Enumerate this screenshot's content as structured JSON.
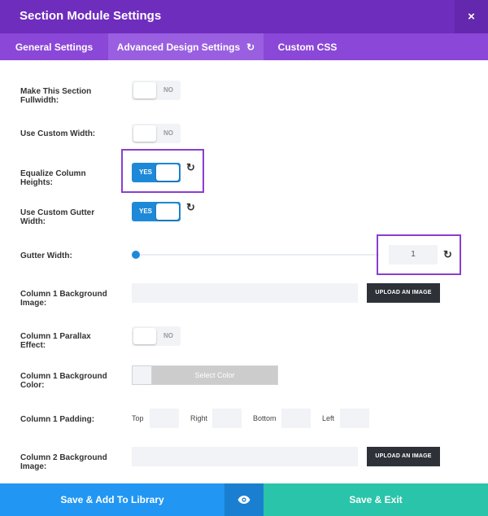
{
  "window": {
    "title": "Section Module Settings",
    "close_icon": "×"
  },
  "tabs": [
    {
      "label": "General Settings"
    },
    {
      "label": "Advanced Design Settings",
      "reset_icon": "↻"
    },
    {
      "label": "Custom CSS"
    }
  ],
  "settings": {
    "fullwidth": {
      "label": "Make This Section Fullwidth:",
      "state": "NO"
    },
    "custom_width": {
      "label": "Use Custom Width:",
      "state": "NO"
    },
    "equalize": {
      "label": "Equalize Column Heights:",
      "state": "YES"
    },
    "custom_gutter": {
      "label": "Use Custom Gutter Width:",
      "state": "YES"
    },
    "gutter_width": {
      "label": "Gutter Width:",
      "value": "1"
    },
    "col1_bg_image": {
      "label": "Column 1 Background Image:",
      "button": "UPLOAD AN IMAGE"
    },
    "col1_parallax": {
      "label": "Column 1 Parallax Effect:",
      "state": "NO"
    },
    "col1_bg_color": {
      "label": "Column 1 Background Color:",
      "button": "Select Color"
    },
    "col1_padding": {
      "label": "Column 1 Padding:",
      "top": "Top",
      "right": "Right",
      "bottom": "Bottom",
      "left": "Left"
    },
    "col2_bg_image": {
      "label": "Column 2 Background Image:",
      "button": "UPLOAD AN IMAGE"
    }
  },
  "reset_icon": "↻",
  "footer": {
    "save_library": "Save & Add To Library",
    "save_exit": "Save & Exit"
  },
  "colors": {
    "header": "#6f2dbd",
    "tabbar": "#8b47d8",
    "toggle_on": "#1e89d8",
    "library_btn": "#2196f3",
    "exit_btn": "#29c4a9",
    "highlight": "#8a3fcf"
  }
}
